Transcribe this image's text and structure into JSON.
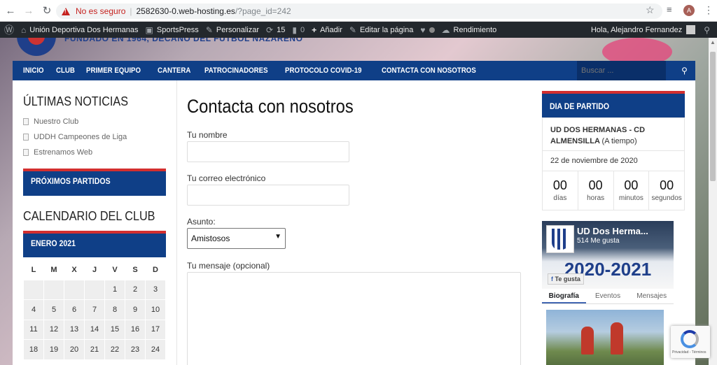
{
  "browser": {
    "insecure_label": "No es seguro",
    "url_host": "2582630-0.web-hosting.es",
    "url_path": "/?page_id=242",
    "profile_initial": "A"
  },
  "admin_bar": {
    "site_name": "Unión Deportiva Dos Hermanas",
    "sportspress": "SportsPress",
    "customize": "Personalizar",
    "updates_count": "15",
    "comments_count": "0",
    "add_new": "Añadir",
    "edit_page": "Editar la página",
    "performance": "Rendimiento",
    "greeting": "Hola, Alejandro Fernandez"
  },
  "site": {
    "tagline": "FUNDADO EN 1964, DECANO DEL FÚTBOL NAZARENO"
  },
  "nav": {
    "items": [
      {
        "label": "INICIO"
      },
      {
        "label": "CLUB"
      },
      {
        "label": "PRIMER EQUIPO"
      },
      {
        "label": "CANTERA"
      },
      {
        "label": "PATROCINADORES"
      },
      {
        "label": "PROTOCOLO COVID-19"
      },
      {
        "label": "CONTACTA CON NOSOTROS"
      }
    ],
    "search_placeholder": "Buscar ..."
  },
  "left_sidebar": {
    "news_title": "ÚLTIMAS NOTICIAS",
    "news": [
      {
        "label": "Nuestro Club"
      },
      {
        "label": "UDDH Campeones de Liga"
      },
      {
        "label": "Estrenamos Web"
      }
    ],
    "upcoming_title": "PRÓXIMOS PARTIDOS",
    "calendar_title": "CALENDARIO DEL CLUB",
    "calendar_month": "ENERO 2021",
    "weekdays": [
      "L",
      "M",
      "X",
      "J",
      "V",
      "S",
      "D"
    ],
    "weeks": [
      [
        "",
        "",
        "",
        "",
        "1",
        "2",
        "3"
      ],
      [
        "4",
        "5",
        "6",
        "7",
        "8",
        "9",
        "10"
      ],
      [
        "11",
        "12",
        "13",
        "14",
        "15",
        "16",
        "17"
      ],
      [
        "18",
        "19",
        "20",
        "21",
        "22",
        "23",
        "24"
      ]
    ]
  },
  "form": {
    "title": "Contacta con nosotros",
    "name_label": "Tu nombre",
    "email_label": "Tu correo electrónico",
    "subject_label": "Asunto:",
    "subject_value": "Amistosos",
    "message_label": "Tu mensaje (opcional)"
  },
  "right_sidebar": {
    "match_title": "DIA DE PARTIDO",
    "match_teams": "UD DOS HERMANAS - CD ALMENSILLA",
    "match_status": "(A tiempo)",
    "match_date": "22 de noviembre de 2020",
    "countdown": [
      {
        "value": "00",
        "label": "días"
      },
      {
        "value": "00",
        "label": "horas"
      },
      {
        "value": "00",
        "label": "minutos"
      },
      {
        "value": "00",
        "label": "segundos"
      }
    ],
    "fb": {
      "page_name": "UD Dos Herma...",
      "likes": "514 Me gusta",
      "season": "2020-2021",
      "like_button": "Te gusta",
      "tabs": [
        "Biografía",
        "Eventos",
        "Mensajes"
      ]
    }
  },
  "recaptcha": {
    "footer": "Privacidad - Términos"
  }
}
